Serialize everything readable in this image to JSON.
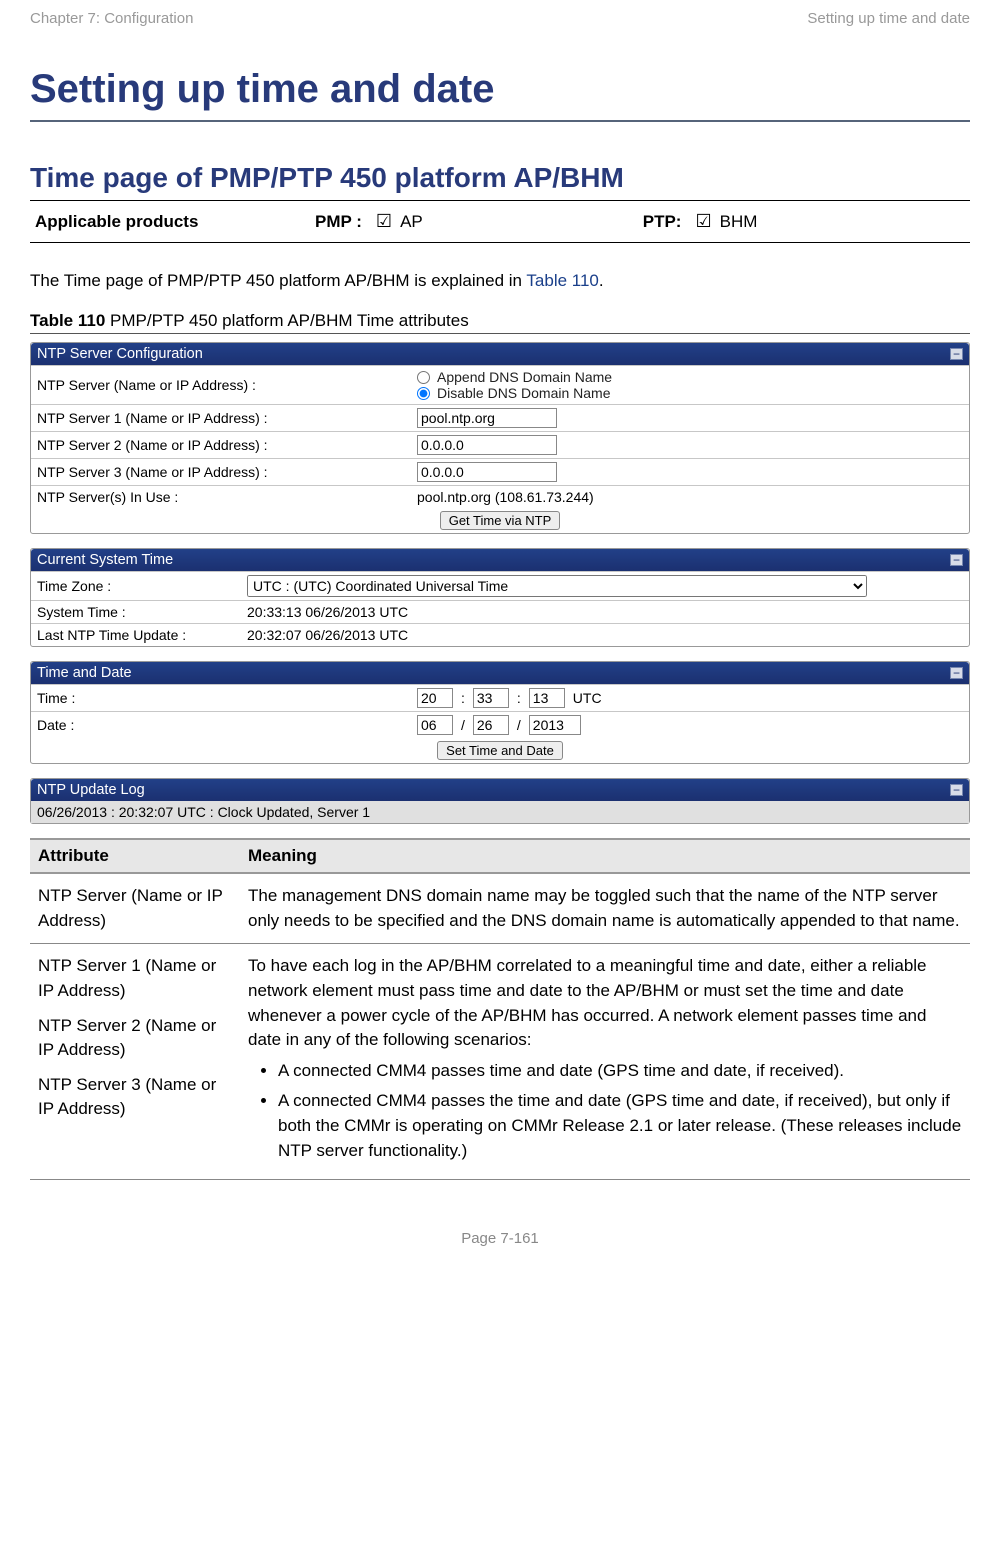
{
  "header": {
    "left": "Chapter 7:  Configuration",
    "right": "Setting up time and date"
  },
  "h1": "Setting up time and date",
  "h2": "Time page of PMP/PTP 450 platform AP/BHM",
  "products": {
    "label": "Applicable products",
    "pmp_label": "PMP :",
    "pmp_check": "☑",
    "pmp_val": "AP",
    "ptp_label": "PTP:",
    "ptp_check": "☑",
    "ptp_val": "BHM"
  },
  "intro_pre": "The Time page of PMP/PTP 450 platform AP/BHM is explained in ",
  "intro_link": "Table 110",
  "intro_post": ".",
  "caption_bold": "Table 110",
  "caption_rest": "  PMP/PTP 450 platform AP/BHM Time attributes",
  "ntp_panel": {
    "title": "NTP Server Configuration",
    "r0_label": "NTP Server (Name or IP Address) :",
    "r0_opt1": "Append DNS Domain Name",
    "r0_opt2": "Disable DNS Domain Name",
    "r1_label": "NTP Server 1 (Name or IP Address) :",
    "r1_val": "pool.ntp.org",
    "r2_label": "NTP Server 2 (Name or IP Address) :",
    "r2_val": "0.0.0.0",
    "r3_label": "NTP Server 3 (Name or IP Address) :",
    "r3_val": "0.0.0.0",
    "r4_label": "NTP Server(s) In Use :",
    "r4_val": "pool.ntp.org (108.61.73.244)",
    "btn": "Get Time via NTP"
  },
  "cst_panel": {
    "title": "Current System Time",
    "r0_label": "Time Zone :",
    "r0_val": "UTC : (UTC) Coordinated Universal Time",
    "r1_label": "System Time :",
    "r1_val": "20:33:13 06/26/2013 UTC",
    "r2_label": "Last NTP Time Update :",
    "r2_val": "20:32:07 06/26/2013 UTC"
  },
  "td_panel": {
    "title": "Time and Date",
    "r0_label": "Time :",
    "hh": "20",
    "mm": "33",
    "ss": "13",
    "tz": "UTC",
    "r1_label": "Date :",
    "mo": "06",
    "da": "26",
    "yr": "2013",
    "btn": "Set Time and Date"
  },
  "log_panel": {
    "title": "NTP Update Log",
    "body": "06/26/2013 : 20:32:07 UTC : Clock Updated, Server 1"
  },
  "attr_head_1": "Attribute",
  "attr_head_2": "Meaning",
  "rowA_name": "NTP Server (Name or IP Address)",
  "rowA_body": "The management DNS domain name may be toggled such that the name of the NTP server only needs to be specified and the DNS domain name is automatically appended to that name.",
  "rowB_name1": "NTP Server 1 (Name or IP Address)",
  "rowB_name2": "NTP Server 2 (Name or IP Address)",
  "rowB_name3": "NTP Server 3 (Name or IP Address)",
  "rowB_body": "To have each log in the AP/BHM correlated to a meaningful time and date, either a reliable network element must pass time and date to the AP/BHM or must set the time and date whenever a power cycle of the AP/BHM has occurred. A network element passes time and date in any of the following scenarios:",
  "rowB_b1": "A connected CMM4 passes time and date (GPS time and date, if received).",
  "rowB_b2": "A connected CMM4 passes the time and date (GPS time and date, if received), but only if both the CMMr is operating on CMMr Release 2.1 or later release. (These releases include NTP server functionality.)",
  "footer": "Page 7-161"
}
